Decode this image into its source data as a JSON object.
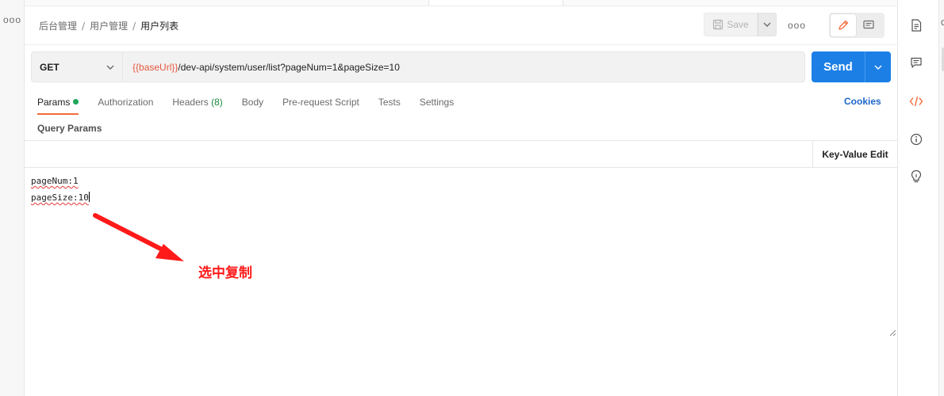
{
  "left_rail": {
    "more": "ooo"
  },
  "breadcrumb": {
    "items": [
      "后台管理",
      "用户管理"
    ],
    "separator": "/",
    "current": "用户列表"
  },
  "header": {
    "save_label": "Save",
    "more": "ooo",
    "icons": [
      "save-icon",
      "chevron-down-icon",
      "pencil-icon",
      "comment-icon"
    ]
  },
  "request": {
    "method": "GET",
    "url_variable": "{{baseUrl}}",
    "url_path": "/dev-api/system/user/list?pageNum=1&pageSize=10",
    "send_label": "Send"
  },
  "tabs": {
    "params": "Params",
    "authorization": "Authorization",
    "headers": "Headers",
    "headers_count": "(8)",
    "body": "Body",
    "pre_request": "Pre-request Script",
    "tests": "Tests",
    "settings": "Settings",
    "cookies": "Cookies"
  },
  "query_params": {
    "title": "Query Params",
    "mode_label": "Key-Value Edit"
  },
  "bulk_edit": {
    "lines": [
      "pageNum:1",
      "pageSize:10"
    ]
  },
  "annotation": {
    "text": "选中复制",
    "color": "#ff1a1a"
  },
  "right_sidebar": {
    "icons": [
      "document-icon",
      "comment-icon",
      "code-icon",
      "info-icon",
      "lightbulb-icon"
    ],
    "edge_char": "C"
  },
  "colors": {
    "accent": "#f26b3a",
    "send": "#1c7fe6",
    "variable": "#e4573e",
    "link": "#1d66c7",
    "status_dot": "#1ea55a"
  }
}
